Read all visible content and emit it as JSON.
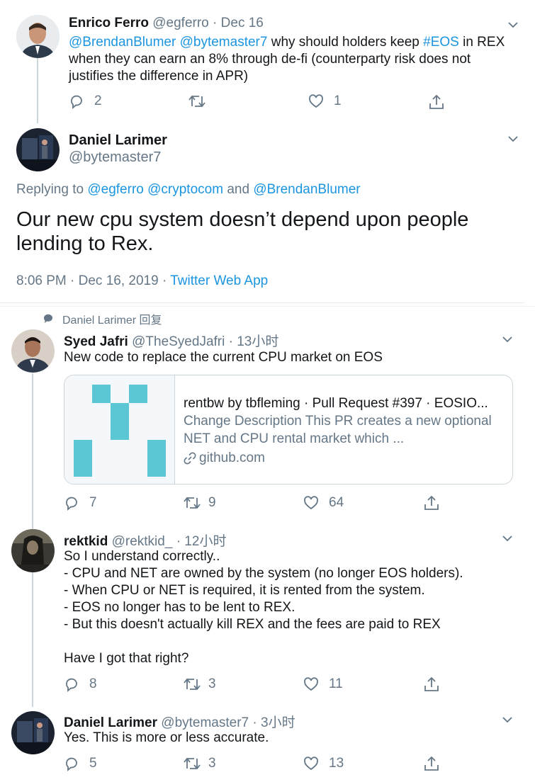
{
  "tweet1": {
    "name": "Enrico Ferro",
    "handle": "@egferro",
    "date": "· Dec 16",
    "mention1": "@BrendanBlumer",
    "mention2": "@bytemaster7",
    "text_a": " why should holders keep ",
    "hashtag": "#EOS",
    "text_b": " in REX when they can earn an 8% through de-fi (counterparty risk does not justifies the difference in APR)",
    "replies": "2",
    "retweets": "",
    "likes": "1"
  },
  "main": {
    "name": "Daniel Larimer",
    "handle": "@bytemaster7",
    "replying_label": "Replying to",
    "replying_handles": "@egferro @cryptocom",
    "replying_and": "and",
    "replying_last": "@BrendanBlumer",
    "text": "Our new cpu system doesn’t depend upon people lending to Rex.",
    "timestamp": "8:06 PM · Dec 16, 2019 ·",
    "source": "Twitter Web App"
  },
  "reply_context": {
    "label": "Daniel Larimer 回复"
  },
  "reply1": {
    "name": "Syed Jafri",
    "handle": "@TheSyedJafri",
    "time": "· 13小时",
    "text": "New code to replace the current CPU market on EOS",
    "card": {
      "title": "rentbw by tbfleming · Pull Request #397 · EOSIO...",
      "description": "Change Description This PR creates a new optional NET and CPU rental market which ...",
      "domain": "github.com"
    },
    "replies": "7",
    "retweets": "9",
    "likes": "64"
  },
  "reply2": {
    "name": "rektkid",
    "handle": "@rektkid_",
    "time": "· 12小时",
    "lines": [
      "So I understand correctly..",
      "- CPU and NET are owned by the system (no longer EOS holders).",
      "- When CPU or NET is required, it is rented from the system.",
      "- EOS no longer has to be lent to REX.",
      "- But this doesn't actually kill REX and the fees are paid to REX"
    ],
    "closing": "Have I got that right?",
    "replies": "8",
    "retweets": "3",
    "likes": "11"
  },
  "reply3": {
    "name": "Daniel Larimer",
    "handle": "@bytemaster7",
    "time": "· 3小时",
    "text": "Yes. This is more or less accurate.",
    "replies": "5",
    "retweets": "3",
    "likes": "13"
  },
  "colors": {
    "link": "#1b95e0",
    "muted": "#657786",
    "card_icon": "#5bc7d5"
  }
}
